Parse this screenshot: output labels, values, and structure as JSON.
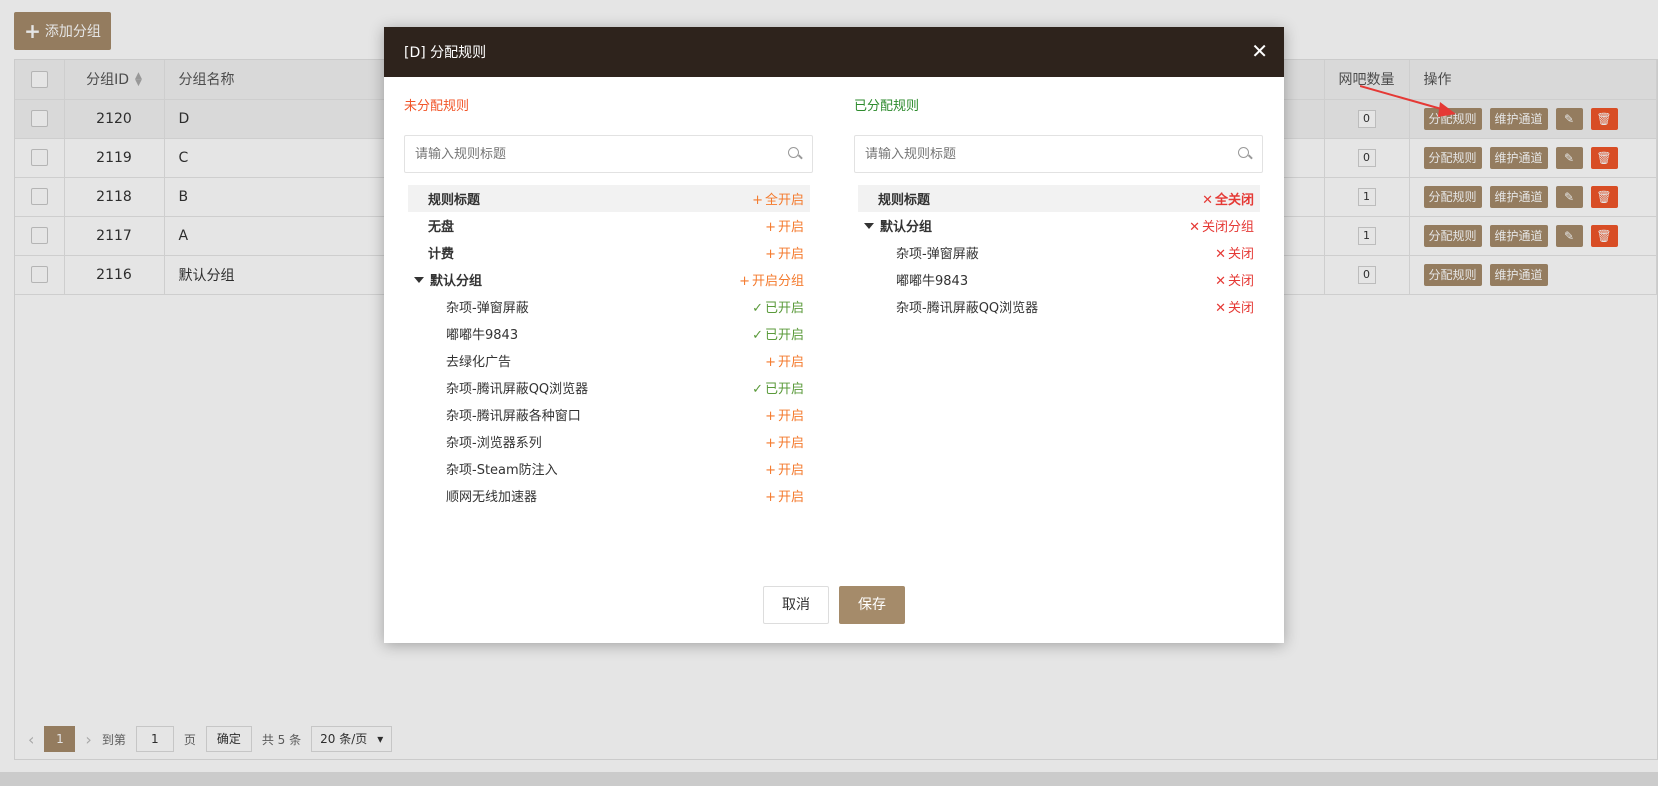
{
  "toolbar": {
    "add_label": "添加分组",
    "add_icon": "plus-icon"
  },
  "table": {
    "headers": {
      "id": "分组ID",
      "name": "分组名称",
      "net_count": "网吧数量",
      "ops": "操作"
    },
    "rows": [
      {
        "id": "2120",
        "name": "D",
        "count": "0",
        "ops": [
          "分配规则",
          "维护通道"
        ],
        "editable": true,
        "selected": true
      },
      {
        "id": "2119",
        "name": "C",
        "count": "0",
        "ops": [
          "分配规则",
          "维护通道"
        ],
        "editable": true
      },
      {
        "id": "2118",
        "name": "B",
        "count": "1",
        "ops": [
          "分配规则",
          "维护通道"
        ],
        "editable": true
      },
      {
        "id": "2117",
        "name": "A",
        "count": "1",
        "ops": [
          "分配规则",
          "维护通道"
        ],
        "editable": true
      },
      {
        "id": "2116",
        "name": "默认分组",
        "count": "0",
        "ops": [
          "分配规则",
          "维护通道"
        ],
        "editable": false
      }
    ]
  },
  "pager": {
    "current": "1",
    "goto_label": "到第",
    "goto_value": "1",
    "page_label": "页",
    "confirm": "确定",
    "total": "共 5 条",
    "page_size": "20 条/页"
  },
  "modal": {
    "title": "[D] 分配规则",
    "close_icon": "close-icon",
    "left": {
      "title": "未分配规则",
      "search_placeholder": "请输入规则标题",
      "header": {
        "label": "规则标题",
        "action": "全开启",
        "symbol": "+"
      },
      "rows": [
        {
          "label": "无盘",
          "action": "开启",
          "symbol": "+",
          "kind": "orange",
          "level": 0,
          "bold": true
        },
        {
          "label": "计费",
          "action": "开启",
          "symbol": "+",
          "kind": "orange",
          "level": 0,
          "bold": true
        },
        {
          "label": "默认分组",
          "action": "开启分组",
          "symbol": "+",
          "kind": "orange",
          "level": 0,
          "bold": true,
          "group": true
        },
        {
          "label": "杂项-弹窗屏蔽",
          "action": "已开启",
          "symbol": "✓",
          "kind": "green",
          "level": 1
        },
        {
          "label": "嘟嘟牛9843",
          "action": "已开启",
          "symbol": "✓",
          "kind": "green",
          "level": 1
        },
        {
          "label": "去绿化广告",
          "action": "开启",
          "symbol": "+",
          "kind": "orange",
          "level": 1
        },
        {
          "label": "杂项-腾讯屏蔽QQ浏览器",
          "action": "已开启",
          "symbol": "✓",
          "kind": "green",
          "level": 1
        },
        {
          "label": "杂项-腾讯屏蔽各种窗口",
          "action": "开启",
          "symbol": "+",
          "kind": "orange",
          "level": 1
        },
        {
          "label": "杂项-浏览器系列",
          "action": "开启",
          "symbol": "+",
          "kind": "orange",
          "level": 1
        },
        {
          "label": "杂项-Steam防注入",
          "action": "开启",
          "symbol": "+",
          "kind": "orange",
          "level": 1
        },
        {
          "label": "顺网无线加速器",
          "action": "开启",
          "symbol": "+",
          "kind": "orange",
          "level": 1
        }
      ]
    },
    "right": {
      "title": "已分配规则",
      "search_placeholder": "请输入规则标题",
      "header": {
        "label": "规则标题",
        "action": "全关闭",
        "symbol": "✕"
      },
      "rows": [
        {
          "label": "默认分组",
          "action": "关闭分组",
          "symbol": "✕",
          "kind": "red",
          "level": 0,
          "bold": true,
          "group": true
        },
        {
          "label": "杂项-弹窗屏蔽",
          "action": "关闭",
          "symbol": "✕",
          "kind": "red",
          "level": 1
        },
        {
          "label": "嘟嘟牛9843",
          "action": "关闭",
          "symbol": "✕",
          "kind": "red",
          "level": 1
        },
        {
          "label": "杂项-腾讯屏蔽QQ浏览器",
          "action": "关闭",
          "symbol": "✕",
          "kind": "red",
          "level": 1
        }
      ]
    },
    "cancel": "取消",
    "save": "保存"
  },
  "colors": {
    "brand": "#a58b6a",
    "danger": "#f1562a",
    "modal_header": "#2e231c"
  }
}
